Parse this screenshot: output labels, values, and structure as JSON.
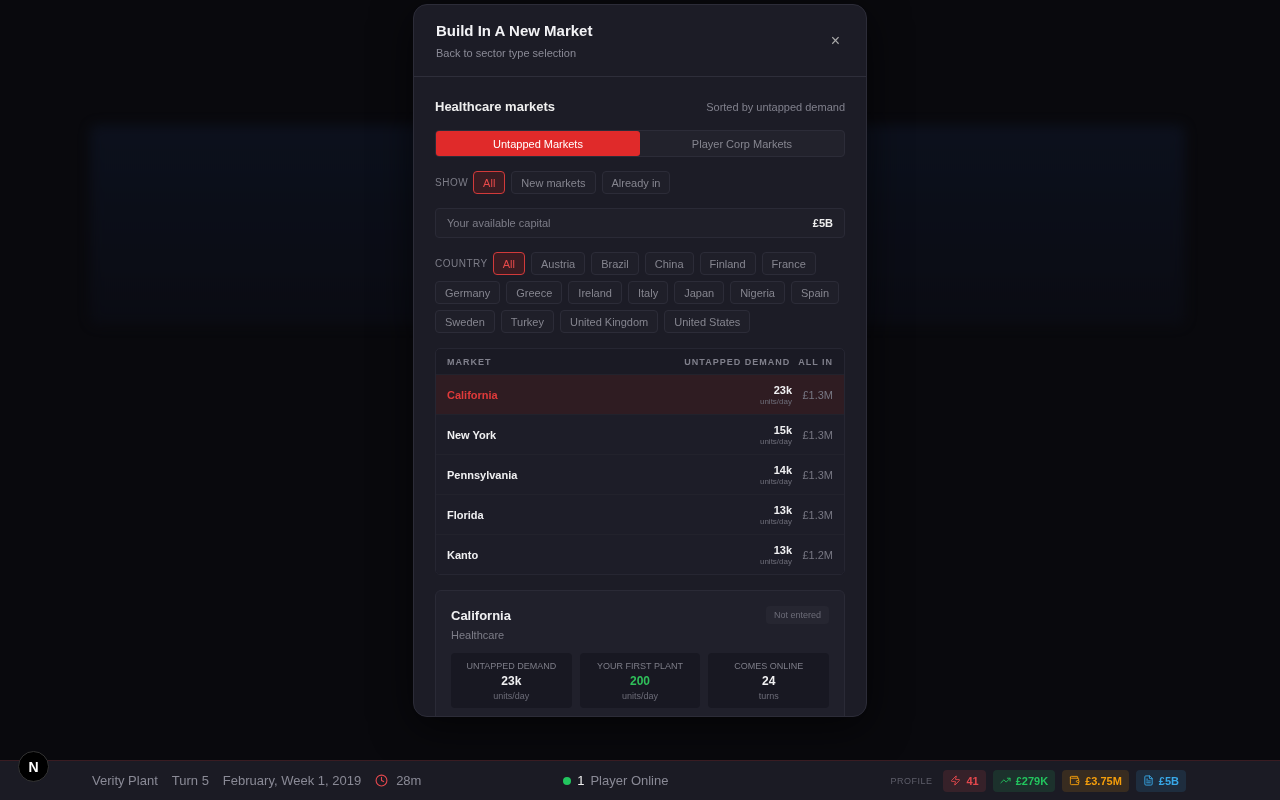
{
  "modal": {
    "title": "Build In A New Market",
    "subtitle": "Back to sector type selection",
    "close": "×"
  },
  "section": {
    "title": "Healthcare markets",
    "sort_note": "Sorted by untapped demand"
  },
  "tabs": [
    {
      "label": "Untapped Markets",
      "selected": true
    },
    {
      "label": "Player Corp Markets",
      "selected": false
    }
  ],
  "show_filter": {
    "label": "SHOW",
    "options": [
      {
        "label": "All",
        "selected": true
      },
      {
        "label": "New markets",
        "selected": false
      },
      {
        "label": "Already in",
        "selected": false
      }
    ]
  },
  "capital": {
    "label": "Your available capital",
    "value": "£5B"
  },
  "country_filter": {
    "label": "COUNTRY",
    "options": [
      {
        "label": "All",
        "selected": true
      },
      {
        "label": "Austria",
        "selected": false
      },
      {
        "label": "Brazil",
        "selected": false
      },
      {
        "label": "China",
        "selected": false
      },
      {
        "label": "Finland",
        "selected": false
      },
      {
        "label": "France",
        "selected": false
      },
      {
        "label": "Germany",
        "selected": false
      },
      {
        "label": "Greece",
        "selected": false
      },
      {
        "label": "Ireland",
        "selected": false
      },
      {
        "label": "Italy",
        "selected": false
      },
      {
        "label": "Japan",
        "selected": false
      },
      {
        "label": "Nigeria",
        "selected": false
      },
      {
        "label": "Spain",
        "selected": false
      },
      {
        "label": "Sweden",
        "selected": false
      },
      {
        "label": "Turkey",
        "selected": false
      },
      {
        "label": "United Kingdom",
        "selected": false
      },
      {
        "label": "United States",
        "selected": false
      }
    ]
  },
  "table": {
    "columns": [
      "MARKET",
      "UNTAPPED DEMAND",
      "ALL IN"
    ],
    "rows": [
      {
        "market": "California",
        "demand": "23k",
        "unit": "units/day",
        "cost": "£1.3M",
        "selected": true
      },
      {
        "market": "New York",
        "demand": "15k",
        "unit": "units/day",
        "cost": "£1.3M",
        "selected": false
      },
      {
        "market": "Pennsylvania",
        "demand": "14k",
        "unit": "units/day",
        "cost": "£1.3M",
        "selected": false
      },
      {
        "market": "Florida",
        "demand": "13k",
        "unit": "units/day",
        "cost": "£1.3M",
        "selected": false
      },
      {
        "market": "Kanto",
        "demand": "13k",
        "unit": "units/day",
        "cost": "£1.2M",
        "selected": false
      }
    ]
  },
  "detail": {
    "title": "California",
    "subtitle": "Healthcare",
    "badge": "Not entered",
    "stats": [
      {
        "label": "UNTAPPED DEMAND",
        "value": "23k",
        "unit": "units/day",
        "highlight": false
      },
      {
        "label": "YOUR FIRST PLANT",
        "value": "200",
        "unit": "units/day",
        "highlight": true
      },
      {
        "label": "COMES ONLINE",
        "value": "24",
        "unit": "turns",
        "highlight": false
      }
    ]
  },
  "status_bar": {
    "logo": "N",
    "items": [
      "Verity Plant",
      "Turn 5",
      "February, Week 1, 2019"
    ],
    "timer": "28m",
    "online_count": "1",
    "online_label": "Player Online",
    "profile_label": "PROFILE",
    "chips": [
      {
        "kind": "energy",
        "value": "41",
        "color": "#e5484d"
      },
      {
        "kind": "income",
        "value": "£279K",
        "color": "#22c55e"
      },
      {
        "kind": "cash",
        "value": "£3.75M",
        "color": "#f59e0b"
      },
      {
        "kind": "capital",
        "value": "£5B",
        "color": "#38a8e8"
      }
    ]
  }
}
